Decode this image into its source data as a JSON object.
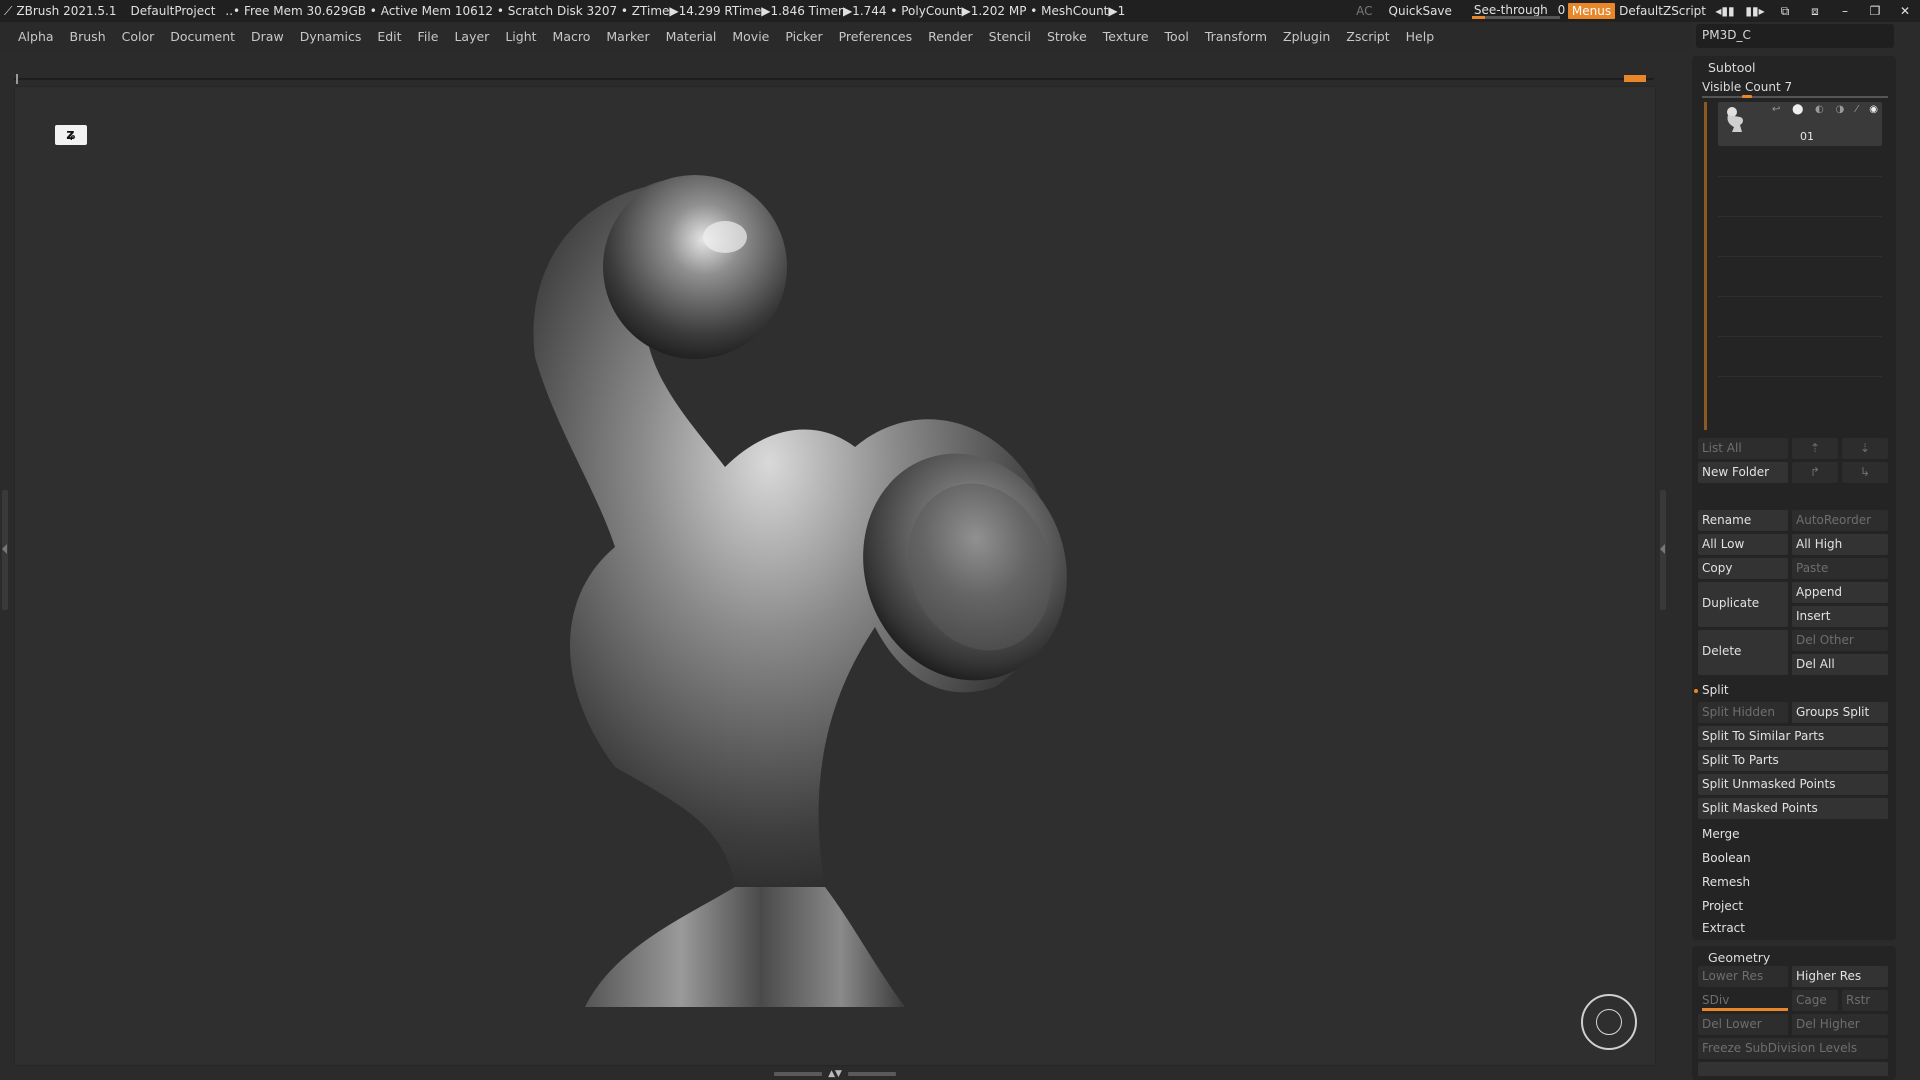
{
  "titlebar": {
    "app": "ZBrush 2021.5.1",
    "project": "DefaultProject",
    "stats": "..• Free Mem 30.629GB • Active Mem 10612 • Scratch Disk 3207 • ZTime▶14.299 RTime▶1.846 Timer▶1.744 • PolyCount▶1.202 MP • MeshCount▶1",
    "ac": "AC",
    "quicksave": "QuickSave",
    "see_through_label": "See-through",
    "see_through_value": "0",
    "see_through_level": 0.15,
    "menus": "Menus",
    "script": "DefaultZScript"
  },
  "menubar": [
    "Alpha",
    "Brush",
    "Color",
    "Document",
    "Draw",
    "Dynamics",
    "Edit",
    "File",
    "Layer",
    "Light",
    "Macro",
    "Marker",
    "Material",
    "Movie",
    "Picker",
    "Preferences",
    "Render",
    "Stencil",
    "Stroke",
    "Texture",
    "Tool",
    "Transform",
    "Zplugin",
    "Zscript",
    "Help"
  ],
  "tool_name": "PM3D_C",
  "subtool": {
    "title": "Subtool",
    "visible_count": "Visible Count 7",
    "item_name": "01",
    "list_all": "List All",
    "new_folder": "New Folder",
    "rename": "Rename",
    "auto_reorder": "AutoReorder",
    "all_low": "All Low",
    "all_high": "All High",
    "copy": "Copy",
    "paste": "Paste",
    "duplicate": "Duplicate",
    "append": "Append",
    "insert": "Insert",
    "delete": "Delete",
    "del_other": "Del Other",
    "del_all": "Del All",
    "split": "Split",
    "split_hidden": "Split Hidden",
    "groups_split": "Groups Split",
    "split_similar": "Split To Similar Parts",
    "split_parts": "Split To Parts",
    "split_unmasked": "Split Unmasked Points",
    "split_masked": "Split Masked Points",
    "merge": "Merge",
    "boolean": "Boolean",
    "remesh": "Remesh",
    "project": "Project",
    "extract": "Extract"
  },
  "geometry": {
    "title": "Geometry",
    "lower_res": "Lower Res",
    "higher_res": "Higher Res",
    "sdiv": "SDiv",
    "cage": "Cage",
    "rstr": "Rstr",
    "del_lower": "Del Lower",
    "del_higher": "Del Higher",
    "freeze": "Freeze SubDivision Levels"
  },
  "colors": {
    "accent": "#e8862a",
    "background": "#2b2b2b",
    "panel": "#242424"
  }
}
